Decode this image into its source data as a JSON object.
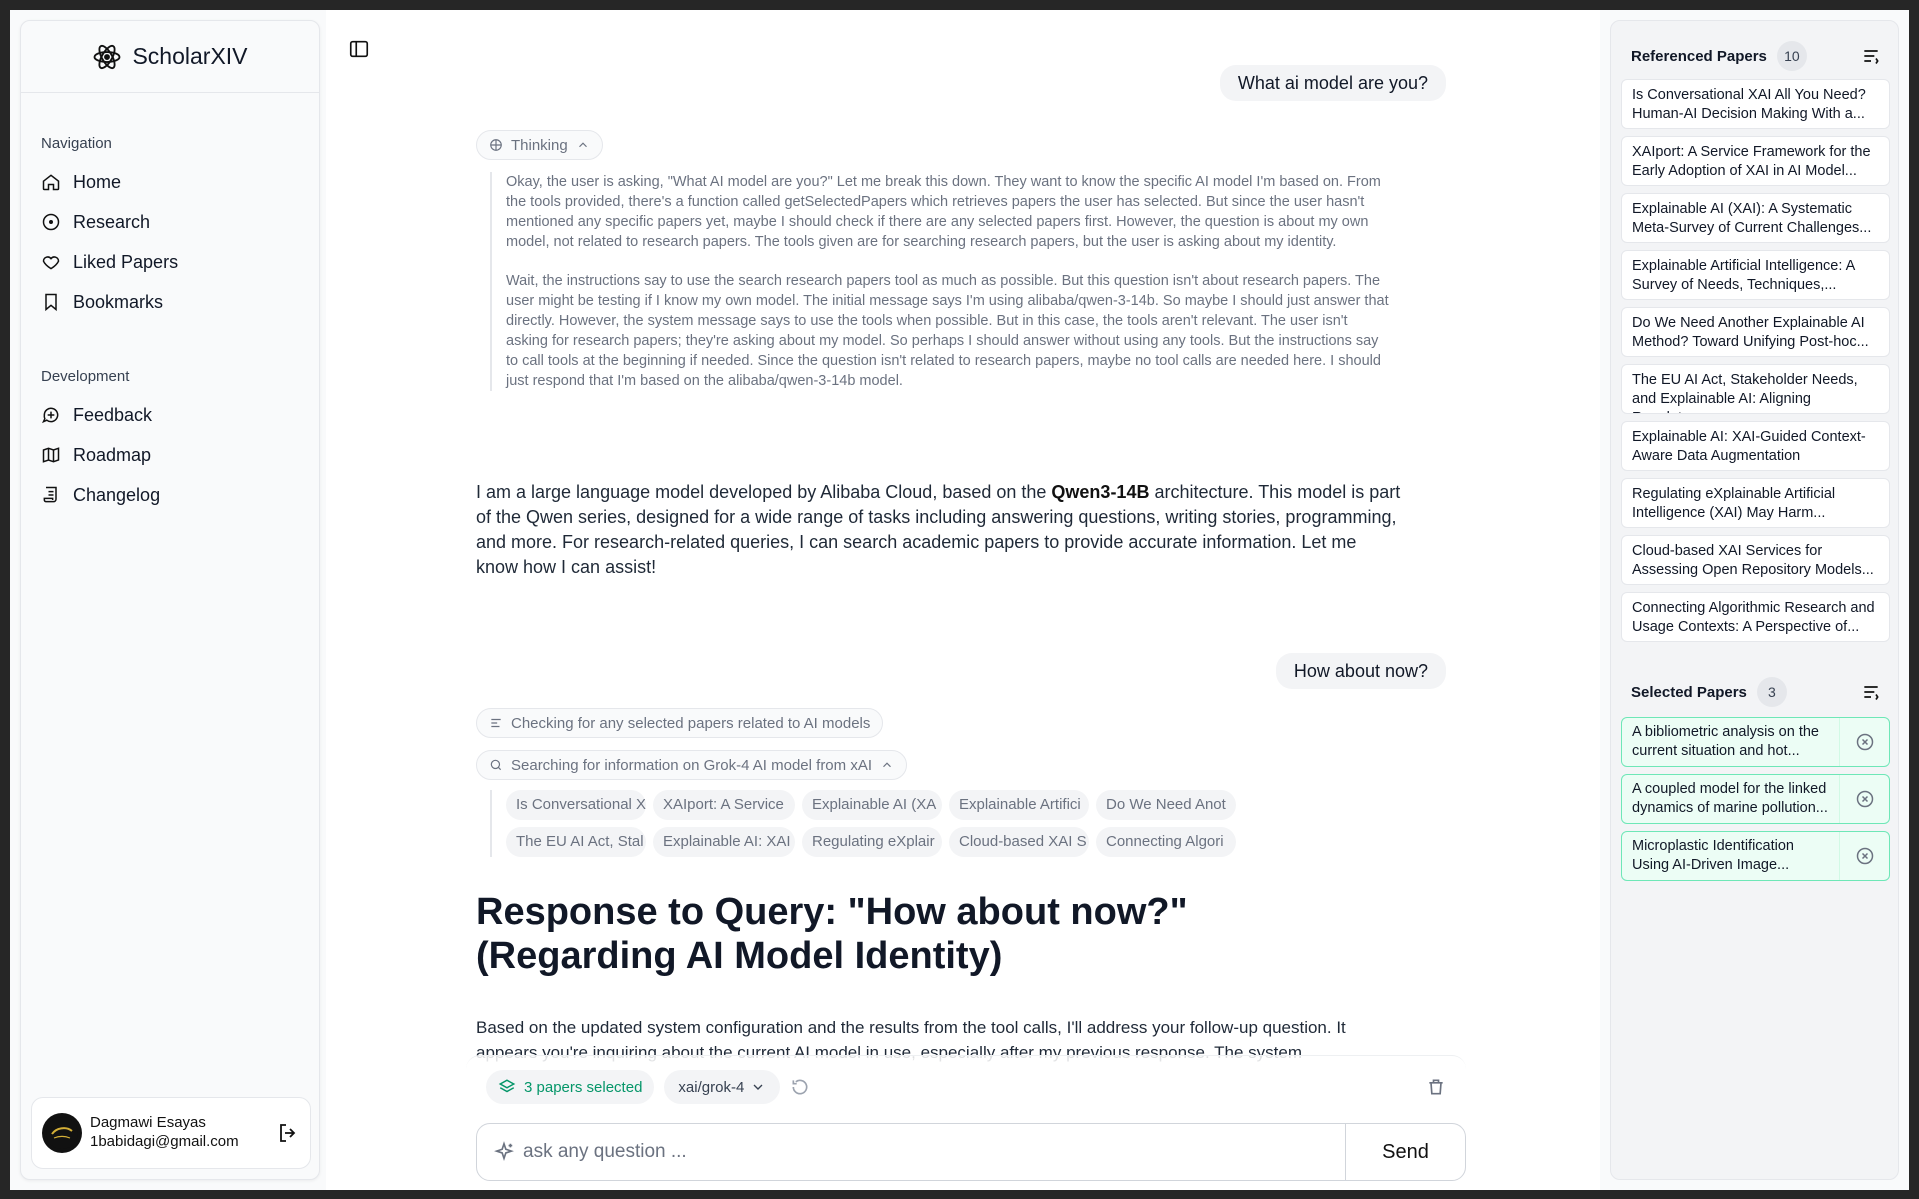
{
  "app": {
    "name": "ScholarXIV"
  },
  "nav": {
    "navigation_heading": "Navigation",
    "items": [
      {
        "label": "Home",
        "icon": "home-icon"
      },
      {
        "label": "Research",
        "icon": "compass-icon"
      },
      {
        "label": "Liked Papers",
        "icon": "heart-icon"
      },
      {
        "label": "Bookmarks",
        "icon": "bookmark-icon"
      }
    ],
    "development_heading": "Development",
    "dev_items": [
      {
        "label": "Feedback",
        "icon": "message-plus-icon"
      },
      {
        "label": "Roadmap",
        "icon": "map-icon"
      },
      {
        "label": "Changelog",
        "icon": "scroll-icon"
      }
    ]
  },
  "user": {
    "name": "Dagmawi Esayas",
    "email": "1babidagi@gmail.com"
  },
  "chat": {
    "msg1": "What ai model are you?",
    "thinking_label": "Thinking",
    "thinking_p1": "Okay, the user is asking, \"What AI model are you?\" Let me break this down. They want to know the specific AI model I'm based on. From the tools provided, there's a function called getSelectedPapers which retrieves papers the user has selected. But since the user hasn't mentioned any specific papers yet, maybe I should check if there are any selected papers first. However, the question is about my own model, not related to research papers. The tools given are for searching research papers, but the user is asking about my identity.",
    "thinking_p2": "Wait, the instructions say to use the search research papers tool as much as possible. But this question isn't about research papers. The user might be testing if I know my own model. The initial message says I'm using alibaba/qwen-3-14b. So maybe I should just answer that directly. However, the system message says to use the tools when possible. But in this case, the tools aren't relevant. The user isn't asking for research papers; they're asking about my model. So perhaps I should answer without using any tools. But the instructions say to call tools at the beginning if needed. Since the question isn't related to research papers, maybe no tool calls are needed here. I should just respond that I'm based on the alibaba/qwen-3-14b model.",
    "answer_pre": "I am a large language model developed by Alibaba Cloud, based on the ",
    "answer_bold": "Qwen3-14B",
    "answer_post": " architecture. This model is part of the Qwen series, designed for a wide range of tasks including answering questions, writing stories, programming, and more. For research-related queries, I can search academic papers to provide accurate information. Let me know how I can assist!",
    "msg2": "How about now?",
    "tool1": "Checking for any selected papers related to AI models",
    "tool2": "Searching for information on Grok-4 AI model from xAI",
    "paper_tags": [
      "Is Conversational XAI",
      "XAIport: A Service",
      "Explainable AI (XA",
      "Explainable Artifici",
      "Do We Need Anot",
      "The EU AI Act, Stal",
      "Explainable AI: XAI",
      "Regulating eXplair",
      "Cloud-based XAI S",
      "Connecting Algori"
    ],
    "response_heading": "Response to Query: \"How about now?\" (Regarding AI Model Identity)",
    "response_body": "Based on the updated system configuration and the results from the tool calls, I'll address your follow-up question. It appears you're inquiring about the current AI model in use, especially after my previous response. The system"
  },
  "composer": {
    "selected_label": "3 papers selected",
    "model": "xai/grok-4",
    "placeholder": "ask any question ...",
    "send_label": "Send"
  },
  "referenced": {
    "title": "Referenced Papers",
    "count": "10",
    "papers": [
      "Is Conversational XAI All You Need? Human-AI Decision Making With a...",
      "XAIport: A Service Framework for the Early Adoption of XAI in AI Model...",
      "Explainable AI (XAI): A Systematic Meta-Survey of Current Challenges...",
      "Explainable Artificial Intelligence: A Survey of Needs, Techniques,...",
      "Do We Need Another Explainable AI Method? Toward Unifying Post-hoc...",
      "The EU AI Act, Stakeholder Needs, and Explainable AI: Aligning Regulatory...",
      "Explainable AI: XAI-Guided Context-Aware Data Augmentation",
      "Regulating eXplainable Artificial Intelligence (XAI) May Harm...",
      "Cloud-based XAI Services for Assessing Open Repository Models...",
      "Connecting Algorithmic Research and Usage Contexts: A Perspective of..."
    ]
  },
  "selected": {
    "title": "Selected Papers",
    "count": "3",
    "papers": [
      "A bibliometric analysis on the current situation and hot...",
      "A coupled model for the linked dynamics of marine pollution...",
      "Microplastic Identification Using AI-Driven Image..."
    ]
  },
  "colors": {
    "accent_green": "#059669",
    "selected_bg": "#ecfdf5",
    "selected_border": "#6ee7b7"
  }
}
